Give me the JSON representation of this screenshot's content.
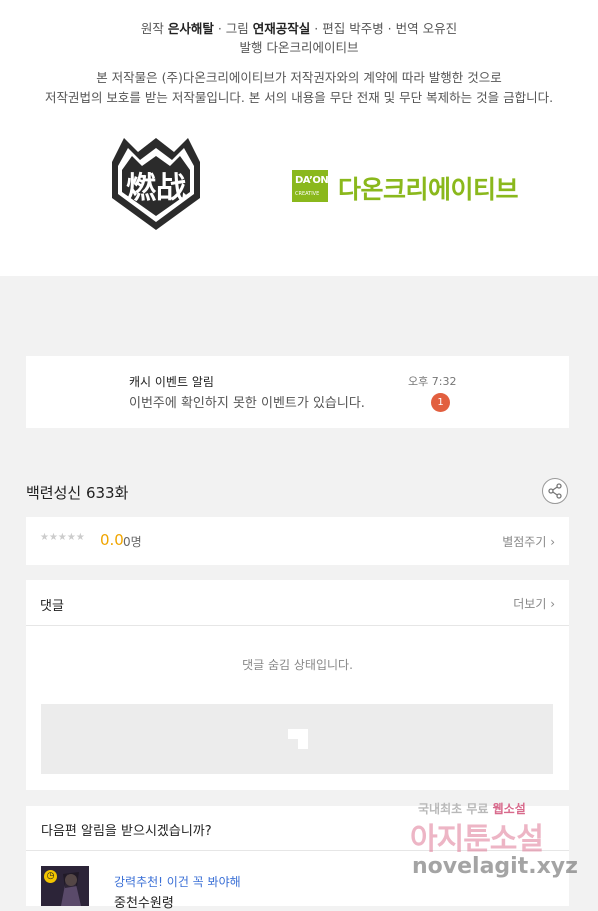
{
  "credits": {
    "line1": {
      "p1": "원작 ",
      "b1": "은사해탈",
      "p2": " · 그림 ",
      "b2": "연재공작실",
      "p3": " · 편집 박주병 · 번역 오유진"
    },
    "line2": "발행 다온크리에이티브",
    "line3": "본 저작물은 (주)다온크리에이티브가 저작권자와의 계약에 따라 발행한 것으로",
    "line4": "저작권법의 보호를 받는 저작물입니다. 본 서의 내용을 무단 전재 및 무단 복제하는 것을 금합니다.",
    "logo_left_text": "燃战",
    "logo_right": {
      "box_top": "DA’ON",
      "box_bottom": "CREATIVE",
      "name": "다온크리에이티브"
    }
  },
  "notification": {
    "title": "캐시 이벤트 알림",
    "message": "이번주에 확인하지 못한 이벤트가 있습니다.",
    "time": "오후 7:32",
    "badge": "1"
  },
  "episode": {
    "title": "백련성신 633화"
  },
  "rating": {
    "stars": "★★★★★",
    "score": "0.0",
    "count": "0명",
    "rate_link": "별점주기 ›"
  },
  "comments": {
    "header": "댓글",
    "more_link": "더보기 ›",
    "hidden_message": "댓글 숨김 상태입니다."
  },
  "next": {
    "question": "다음편 알림을 받으시겠습니까?",
    "recommend": "강력추천! 이건 꼭 봐야해",
    "rec_title": "중천수원령"
  },
  "watermark": {
    "line1_a": "국내최초 무료 ",
    "line1_b": "웹소설",
    "line2": "아지툰소설",
    "line3": "novelagit.xyz"
  },
  "colors": {
    "accent_green": "#8ab81c",
    "score_orange": "#f0a500",
    "badge_red": "#e25f3f",
    "link_blue": "#3a6fd6"
  }
}
